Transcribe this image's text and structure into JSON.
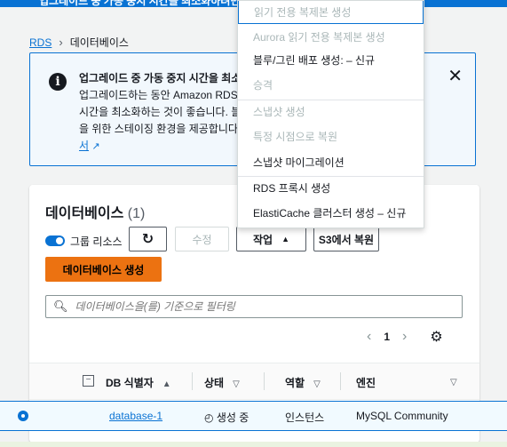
{
  "topbar": {
    "text": "업그레이드 중 가동 중지 시간을 최소화하려면"
  },
  "breadcrumb": {
    "root": "RDS",
    "current": "데이터베이스"
  },
  "flash": {
    "title": "업그레이드 중 가동 중지 시간을 최소",
    "lines": [
      "업그레이드하는 동안 Amazon RDS",
      "시간을 최소화하는 것이 좋습니다. 블",
      "을 위한 스테이징 환경을 제공합니다"
    ],
    "link": "서"
  },
  "panel": {
    "heading": "데이터베이스",
    "count": "(1)",
    "group_resources_label": "그룹 리소스",
    "modify_label": "수정",
    "actions_label": "작업",
    "restore_s3_label": "S3에서 복원",
    "create_label": "데이터베이스 생성",
    "search_placeholder": "데이터베이스을(를) 기준으로 필터링",
    "page": "1"
  },
  "table": {
    "columns": [
      "DB 식별자",
      "상태",
      "역할",
      "엔진"
    ],
    "rows": [
      {
        "id": "database-1",
        "status": "생성 중",
        "role": "인스턴스",
        "engine": "MySQL Community"
      }
    ]
  },
  "dropdown": {
    "items": [
      {
        "label": "읽기 전용 복제본 생성",
        "disabled": true
      },
      {
        "label": "Aurora 읽기 전용 복제본 생성",
        "disabled": true
      },
      {
        "label": "블루/그린 배포 생성: – 신규",
        "disabled": false
      },
      {
        "label": "승격",
        "disabled": true
      },
      {
        "label": "스냅샷 생성",
        "disabled": true
      },
      {
        "label": "특정 시점으로 복원",
        "disabled": true
      },
      {
        "label": "스냅샷 마이그레이션",
        "disabled": false
      },
      {
        "label": "RDS 프록시 생성",
        "disabled": false
      },
      {
        "label": "ElastiCache 클러스터 생성 – 신규",
        "disabled": false
      }
    ]
  },
  "colors": {
    "accent": "#0972d3",
    "primary_button": "#ec7211",
    "disabled_text": "#aab7b8"
  }
}
